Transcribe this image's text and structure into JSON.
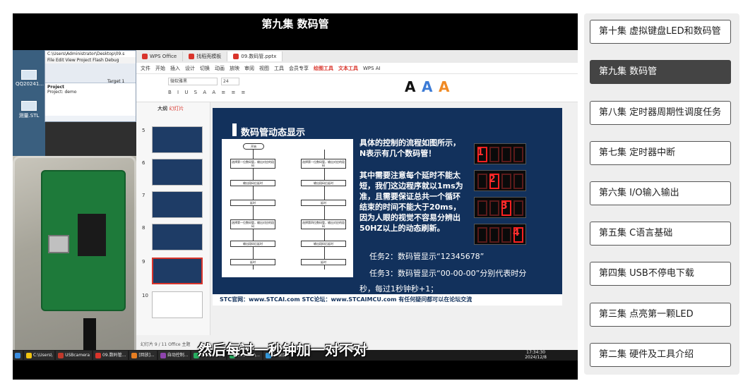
{
  "video": {
    "title": "第九集 数码管",
    "subtitle": "然后每过一秒钟加一对不对"
  },
  "desktop": {
    "icons": [
      {
        "label": "QQ20241..."
      },
      {
        "label": "测量.STL"
      }
    ]
  },
  "keil": {
    "path": "C:\\Users\\Administrator\\Desktop\\09.s",
    "menu": [
      "File",
      "Edit",
      "View",
      "Project",
      "Flash",
      "Debug"
    ],
    "target": "Target 1",
    "project_label": "Project",
    "project_item": "Project: demo"
  },
  "wps": {
    "tabs": [
      {
        "label": "WPS Office"
      },
      {
        "label": "找稻壳模板"
      },
      {
        "label": "09.数码管.pptx"
      }
    ],
    "menu": [
      "文件",
      "开始",
      "插入",
      "设计",
      "切换",
      "动画",
      "放映",
      "审阅",
      "视图",
      "工具",
      "会员专享",
      "绘图工具",
      "文本工具",
      "WPS AI"
    ],
    "font_name": "微软雅黑",
    "font_size": "24",
    "panel_tabs": [
      "大纲",
      "幻灯片"
    ],
    "slide_numbers": [
      "5",
      "6",
      "7",
      "8",
      "9",
      "10"
    ],
    "status_text": "幻灯片 9 / 11    Office 主题"
  },
  "slide": {
    "title": "数码管动态显示",
    "flow": {
      "start": "开始",
      "left": [
        "选择第一位数码管，输出对应的段码",
        "输出段码后延时",
        "延时",
        "选择第一位数码管，输出对应的段码",
        "输出段码后延时",
        "延时"
      ],
      "right": [
        "选择第一位数码管，输出对应的段码",
        "输出段码后延时",
        "延时",
        "选择第四位数码管，输出对应的段码",
        "输出段码后延时",
        "延时"
      ]
    },
    "para1": "具体的控制的流程如图所示，N表示有几个数码管！",
    "para2": "其中需要注意每个延时不能太短，我们这边程序就以1ms为准，且需要保证总共一个循环结束的时间不能大于20ms，因为人眼的视觉不容易分辨出50HZ以上的动态刷新。",
    "digits": [
      "1",
      "2",
      "3",
      "4"
    ],
    "task2": "任务2：数码管显示“12345678”",
    "task3": "任务3：数码管显示“00-00-00”分别代表时分",
    "task3b": "秒，每过1秒钟秒+1；",
    "footer": "STC官网：www.STCAI.com      STC论坛：www.STCAIMCU.com      有任何疑问都可以在论坛交流"
  },
  "taskbar": {
    "items": [
      "C:\\Users\\",
      "USBcamera",
      "09.数码管...",
      "[回放]...",
      "自动控制...",
      "C:\\Users\\...",
      "C:\\Users\\...",
      "FV录屏"
    ],
    "time": "17:34:30",
    "date": "2024/12/8"
  },
  "playlist": [
    {
      "label": "第十集 虚拟键盘LED和数码管",
      "active": false
    },
    {
      "label": "第九集 数码管",
      "active": true
    },
    {
      "label": "第八集 定时器周期性调度任务",
      "active": false
    },
    {
      "label": "第七集 定时器中断",
      "active": false
    },
    {
      "label": "第六集 I/O输入输出",
      "active": false
    },
    {
      "label": "第五集 C语言基础",
      "active": false
    },
    {
      "label": "第四集 USB不停电下载",
      "active": false
    },
    {
      "label": "第三集 点亮第一颗LED",
      "active": false
    },
    {
      "label": "第二集 硬件及工具介绍",
      "active": false
    }
  ],
  "colors": {
    "accent": "#d9342b",
    "slide_bg": "#12315c",
    "active_episode": "#444444"
  }
}
